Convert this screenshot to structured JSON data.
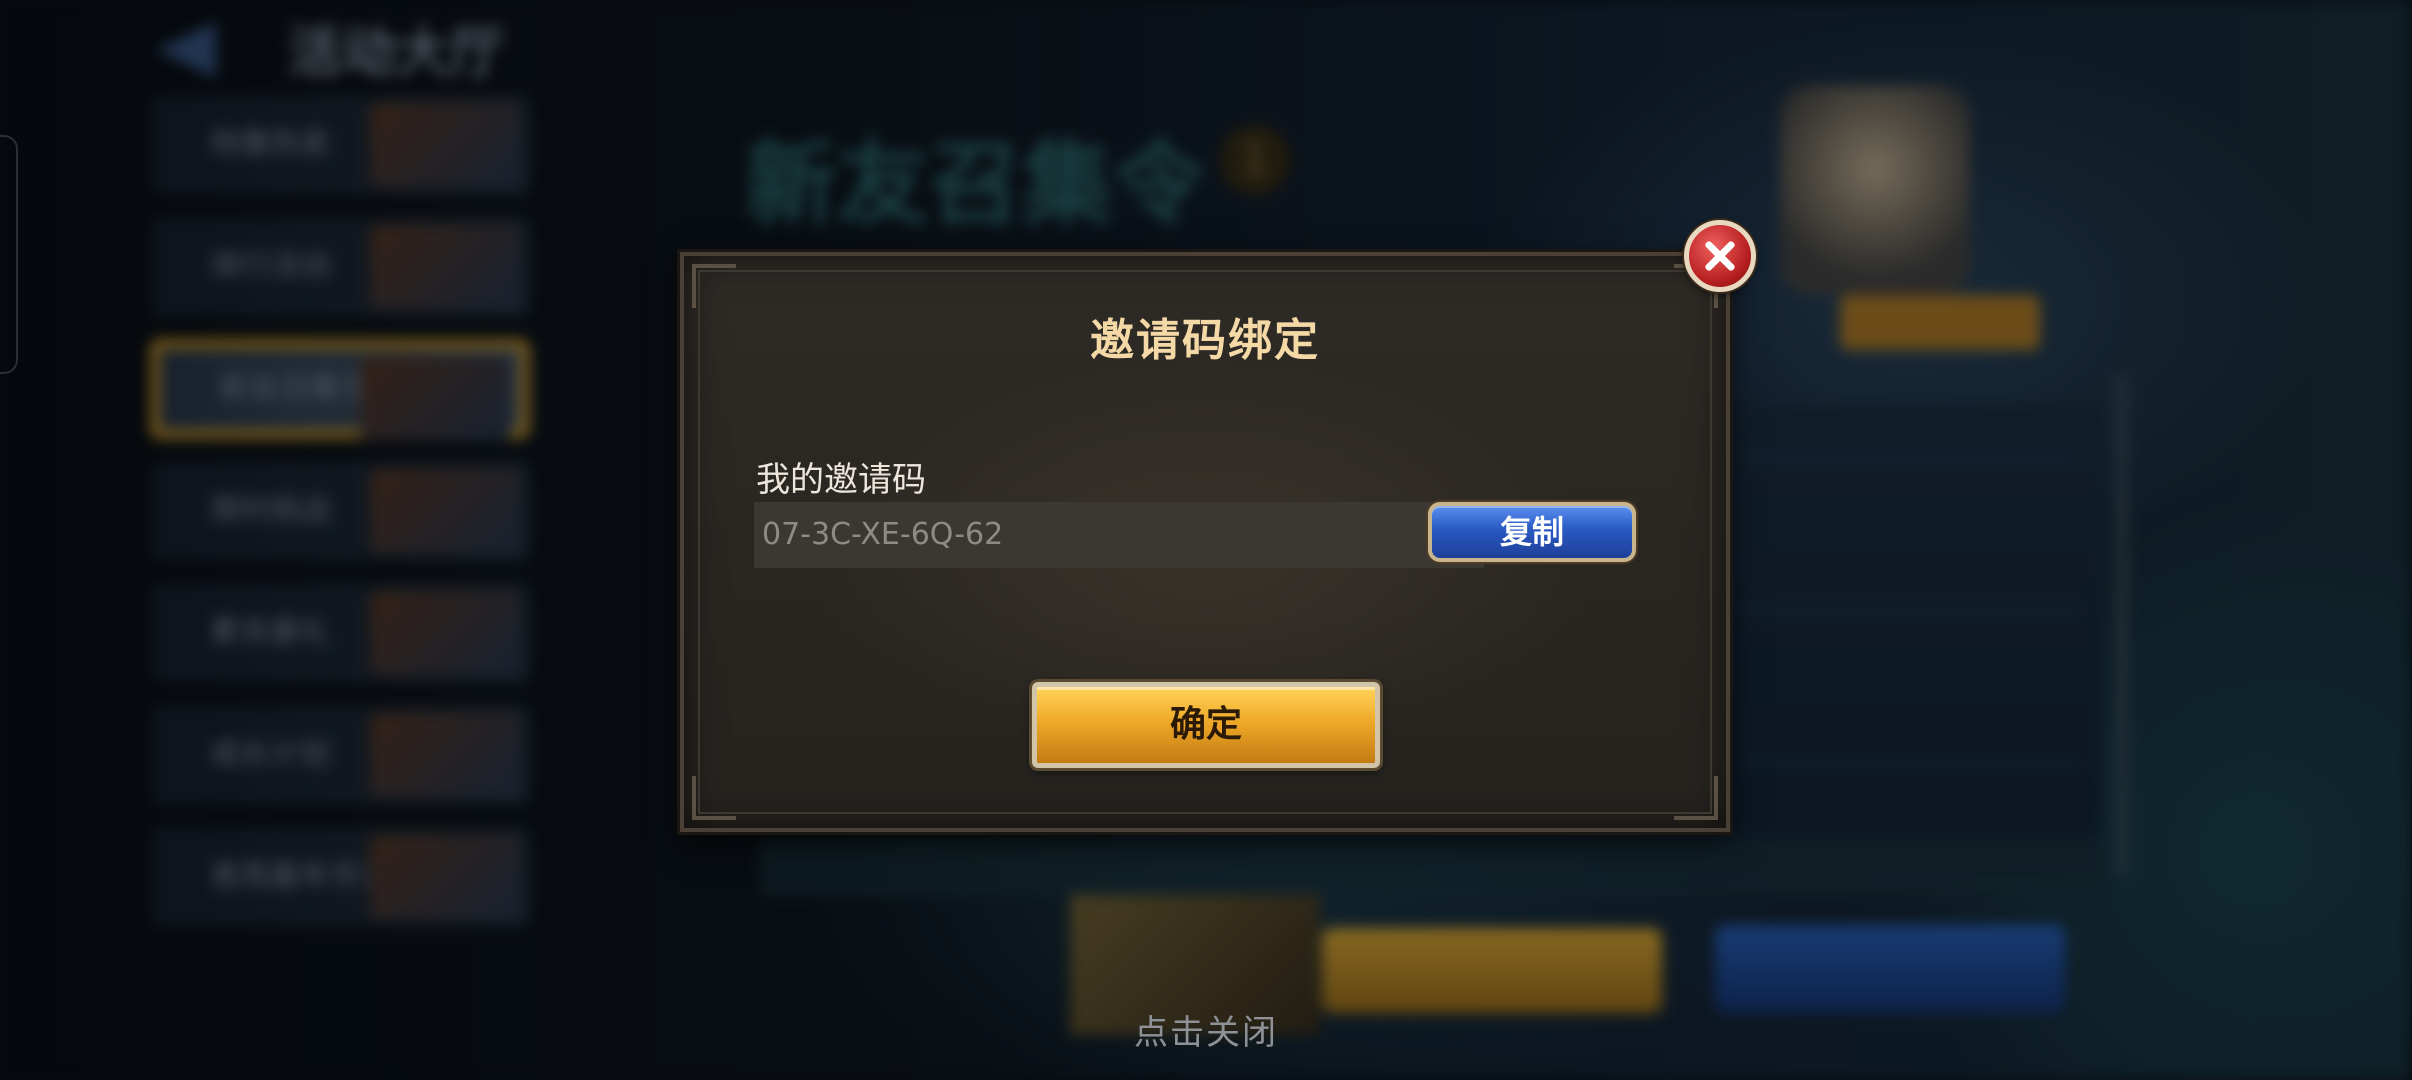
{
  "background": {
    "hall_title": "活动大厅",
    "banner_title": "新友召集令",
    "banner_badge": "1",
    "sidebar_items": [
      "特惠热卖",
      "排行活动",
      "新友召集令",
      "限时挑战",
      "累充豪礼",
      "成长计划",
      "首周嘉年华活动"
    ]
  },
  "dialog": {
    "title": "邀请码绑定",
    "code_label": "我的邀请码",
    "code_value": "07-3C-XE-6Q-62",
    "copy_label": "复制",
    "confirm_label": "确定"
  },
  "footer": {
    "tap_to_close": "点击关闭"
  },
  "colors": {
    "title_gold": "#f4d9a6",
    "copy_blue": "#2a59c4",
    "confirm_gold": "#f0a928",
    "close_red": "#b51e1e"
  },
  "icons": {
    "close": "close-x-icon",
    "back": "back-arrow-icon"
  }
}
